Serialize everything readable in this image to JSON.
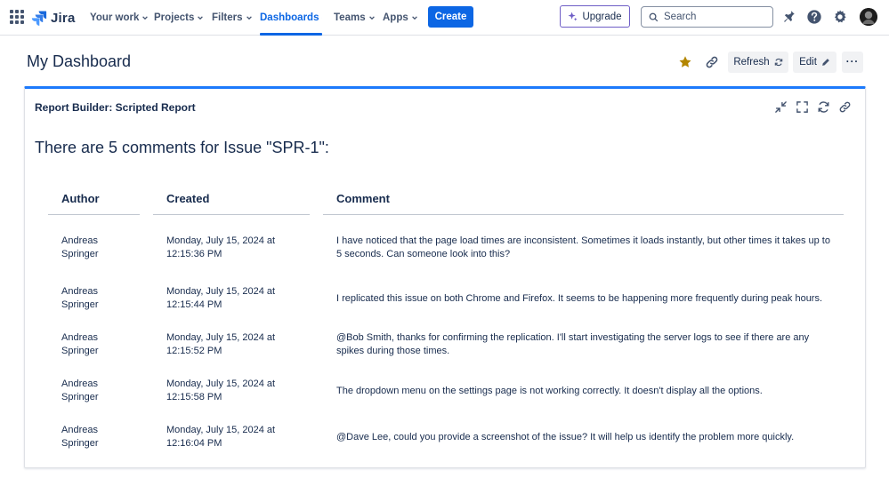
{
  "nav": {
    "logo_text": "Jira",
    "items": [
      {
        "label": "Your work"
      },
      {
        "label": "Projects"
      },
      {
        "label": "Filters"
      },
      {
        "label": "Dashboards"
      },
      {
        "label": "Teams"
      },
      {
        "label": "Apps"
      }
    ],
    "active_item": "Dashboards",
    "create_label": "Create",
    "upgrade_label": "Upgrade",
    "search_placeholder": "Search",
    "icons": [
      "app-switcher-icon",
      "notifications-icon",
      "help-icon",
      "settings-icon"
    ]
  },
  "page": {
    "title": "My Dashboard",
    "refresh_label": "Refresh",
    "edit_label": "Edit",
    "more_label": "···"
  },
  "gadget": {
    "title": "Report Builder: Scripted Report",
    "heading": "There are 5 comments for Issue \"SPR-1\":",
    "columns": [
      "Author",
      "Created",
      "Comment"
    ],
    "rows": [
      {
        "author": "Andreas Springer",
        "created": "Monday, July 15, 2024 at 12:15:36 PM",
        "comment": "I have noticed that the page load times are inconsistent. Sometimes it loads instantly, but other times it takes up to 5 seconds. Can someone look into this?"
      },
      {
        "author": "Andreas Springer",
        "created": "Monday, July 15, 2024 at 12:15:44 PM",
        "comment": "I replicated this issue on both Chrome and Firefox. It seems to be happening more frequently during peak hours."
      },
      {
        "author": "Andreas Springer",
        "created": "Monday, July 15, 2024 at 12:15:52 PM",
        "comment": "@Bob Smith, thanks for confirming the replication. I'll start investigating the server logs to see if there are any spikes during those times."
      },
      {
        "author": "Andreas Springer",
        "created": "Monday, July 15, 2024 at 12:15:58 PM",
        "comment": "The dropdown menu on the settings page is not working correctly. It doesn't display all the options."
      },
      {
        "author": "Andreas Springer",
        "created": "Monday, July 15, 2024 at 12:16:04 PM",
        "comment": "@Dave Lee, could you provide a screenshot of the issue? It will help us identify the problem more quickly."
      }
    ]
  },
  "colors": {
    "accent": "#0c66e4",
    "gadget_border": "#1d7afc",
    "upgrade_border": "#6e5dc6",
    "star": "#b38600",
    "text": "#172b4d"
  }
}
